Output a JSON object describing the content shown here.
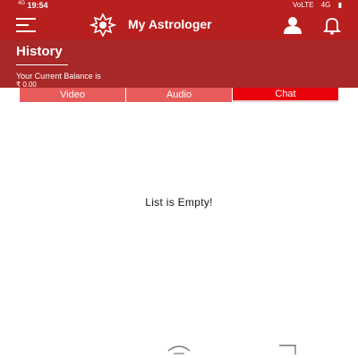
{
  "status_bar": {
    "signal_text": "4G",
    "time": "19:54",
    "right_text": [
      "VoLTE",
      "4G"
    ]
  },
  "app_bar": {
    "title": "My Astrologer",
    "icons": [
      "menu-icon",
      "astrology-logo-icon",
      "profile-icon",
      "bell-icon"
    ]
  },
  "history": {
    "title": "History",
    "balance_label": "Your Current Balance is",
    "balance_value": "₹ 0.00"
  },
  "tabs": [
    {
      "label": "Video"
    },
    {
      "label": "Audio"
    },
    {
      "label": "Chat",
      "selected": true
    }
  ],
  "content": {
    "empty_message": "List is Empty!"
  },
  "colors": {
    "primary": "#b81f1f",
    "header_bg": "#a82727",
    "tab_bg": "#e85b5b",
    "tab_active": "#e8000b"
  }
}
